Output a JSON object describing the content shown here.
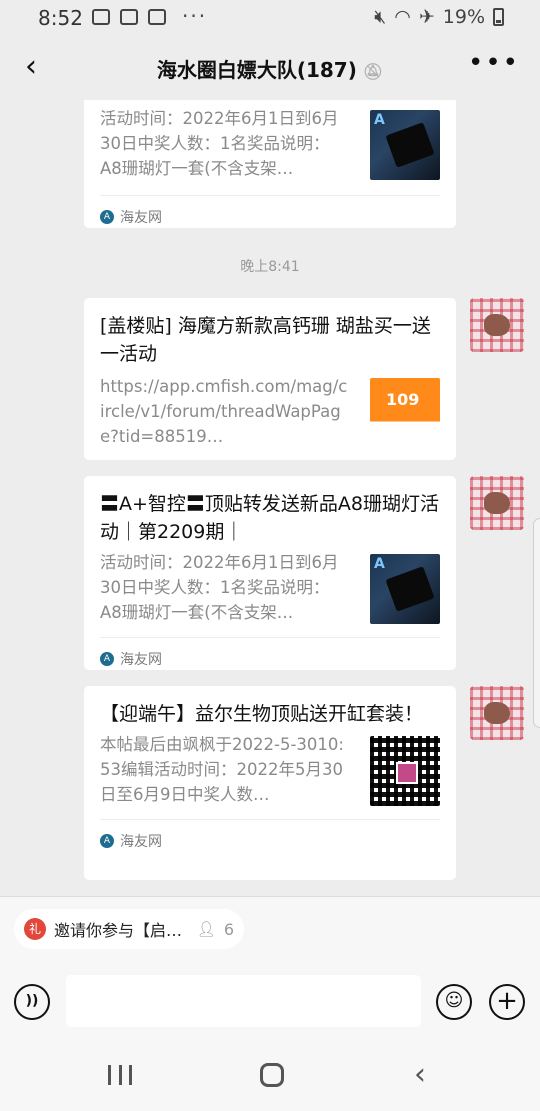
{
  "status_bar": {
    "time": "8:52",
    "dots": "···",
    "battery": "19%"
  },
  "header": {
    "title": "海水圈白嫖大队(187)",
    "mute_icon": "bell-off-icon",
    "more": "•••"
  },
  "messages": [
    {
      "title": "",
      "desc": "活动时间：2022年6月1日到6月30日中奖人数：1名奖品说明：A8珊瑚灯一套(不含支架…",
      "source": "海友网",
      "thumb": "device"
    },
    {
      "timestamp": "晚上8:41",
      "title": "[盖楼贴] 海魔方新款高钙珊 瑚盐买一送一活动",
      "desc": "https://app.cmfish.com/mag/circle/v1/forum/threadWapPage?tid=88519…",
      "source": "",
      "thumb": "promo"
    },
    {
      "title": "〓A+智控〓顶贴转发送新品A8珊瑚灯活动｜第2209期｜",
      "desc": "活动时间：2022年6月1日到6月30日中奖人数：1名奖品说明：A8珊瑚灯一套(不含支架…",
      "source": "海友网",
      "thumb": "device"
    },
    {
      "title": "【迎端午】益尔生物顶贴送开缸套装！",
      "desc": "本帖最后由飒枫于2022-5-3010:53编辑活动时间：2022年5月30日至6月9日中奖人数…",
      "source": "海友网",
      "thumb": "qr"
    }
  ],
  "invite": {
    "text": "邀请你参与【启…",
    "count": "6"
  },
  "input_bar": {
    "voice_label": "))",
    "emoji_label": "☺",
    "plus_label": "+"
  },
  "colors": {
    "background": "#ededed",
    "card": "#ffffff",
    "desc_text": "#8a8a8a",
    "accent_red": "#e2473b"
  }
}
